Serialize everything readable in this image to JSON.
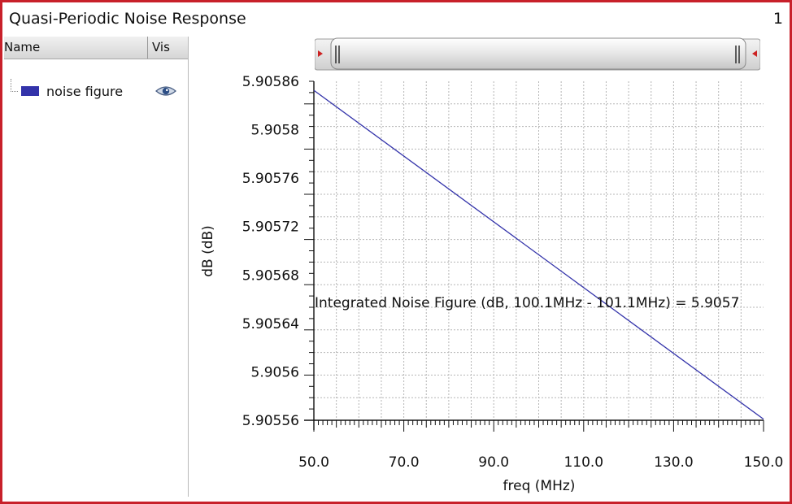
{
  "window": {
    "title": "Quasi-Periodic Noise Response",
    "subwindow_number": "1"
  },
  "legend": {
    "header_name": "Name",
    "header_vis": "Vis",
    "items": [
      {
        "label": "noise figure",
        "color": "#3333aa",
        "visible_icon": "eye-icon"
      }
    ]
  },
  "colors": {
    "frame": "#c8202a",
    "trace": "#3333aa",
    "grid": "#b5b5b5"
  },
  "chart_data": {
    "type": "line",
    "title": "",
    "xlabel": "freq (MHz)",
    "ylabel": "dB (dB)",
    "xlim": [
      50,
      150
    ],
    "ylim": [
      5.90556,
      5.90586
    ],
    "x_ticks": [
      "50.0",
      "70.0",
      "90.0",
      "110.0",
      "130.0",
      "150.0"
    ],
    "y_ticks": [
      "5.90586",
      "5.9058",
      "5.90576",
      "5.90572",
      "5.90568",
      "5.90564",
      "5.9056",
      "5.90556"
    ],
    "grid": true,
    "series": [
      {
        "name": "noise figure",
        "x": [
          50,
          150
        ],
        "y": [
          5.905852,
          5.905561
        ]
      }
    ],
    "annotation": "Integrated Noise Figure (dB, 100.1MHz - 101.1MHz) = 5.9057"
  }
}
